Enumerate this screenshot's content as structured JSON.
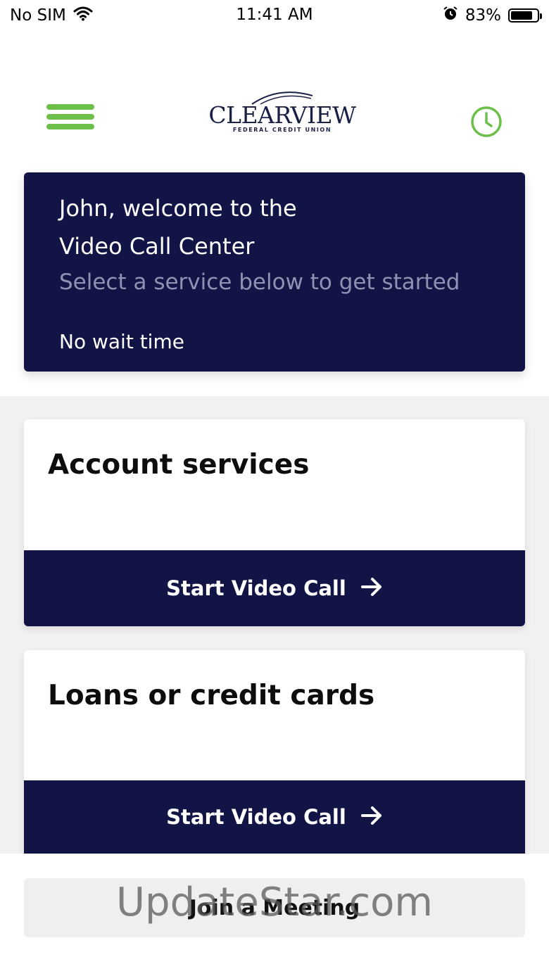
{
  "status_bar": {
    "carrier": "No SIM",
    "time": "11:41 AM",
    "battery_percent": "83%",
    "battery_level": 0.83,
    "icons": [
      "wifi-icon",
      "alarm-icon",
      "battery-icon"
    ]
  },
  "header": {
    "menu_icon": "hamburger-menu-icon",
    "logo_text": "CLEARVIEW",
    "logo_subtext": "FEDERAL CREDIT UNION",
    "history_icon": "clock-icon",
    "accent_color": "#6cc04a"
  },
  "welcome": {
    "title_line1": "John, welcome to the",
    "title_line2": "Video Call Center",
    "subtitle": "Select a service below to get started",
    "wait_text": "No wait time",
    "background_color": "#121446"
  },
  "services": [
    {
      "title": "Account services",
      "button_label": "Start Video Call"
    },
    {
      "title": "Loans or credit cards",
      "button_label": "Start Video Call"
    }
  ],
  "join_button": {
    "label": "Join a Meeting"
  },
  "watermark": "UpdateStar.com"
}
